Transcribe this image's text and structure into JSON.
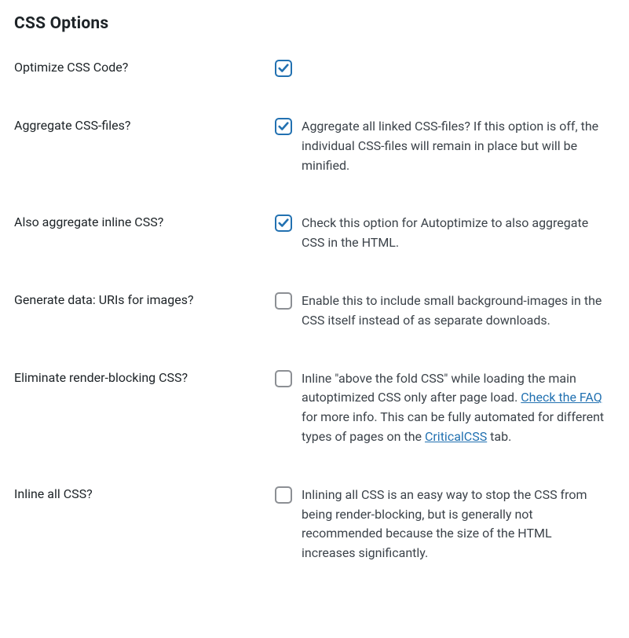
{
  "section_title": "CSS Options",
  "rows": {
    "optimize": {
      "label": "Optimize CSS Code?",
      "checked": true
    },
    "aggregate": {
      "label": "Aggregate CSS-files?",
      "checked": true,
      "desc": "Aggregate all linked CSS-files? If this option is off, the individual CSS-files will remain in place but will be minified."
    },
    "aggregate_inline": {
      "label": "Also aggregate inline CSS?",
      "checked": true,
      "desc": "Check this option for Autoptimize to also aggregate CSS in the HTML."
    },
    "data_uris": {
      "label": "Generate data: URIs for images?",
      "checked": false,
      "desc": "Enable this to include small background-images in the CSS itself instead of as separate downloads."
    },
    "eliminate": {
      "label": "Eliminate render-blocking CSS?",
      "checked": false,
      "desc_pre": "Inline \"above the fold CSS\" while loading the main autoptimized CSS only after page load. ",
      "link1_text": "Check the FAQ",
      "desc_mid": " for more info. This can be fully automated for different types of pages on the ",
      "link2_text": "CriticalCSS",
      "desc_post": " tab."
    },
    "inline_all": {
      "label": "Inline all CSS?",
      "checked": false,
      "desc": "Inlining all CSS is an easy way to stop the CSS from being render-blocking, but is generally not recommended because the size of the HTML increases significantly."
    }
  }
}
